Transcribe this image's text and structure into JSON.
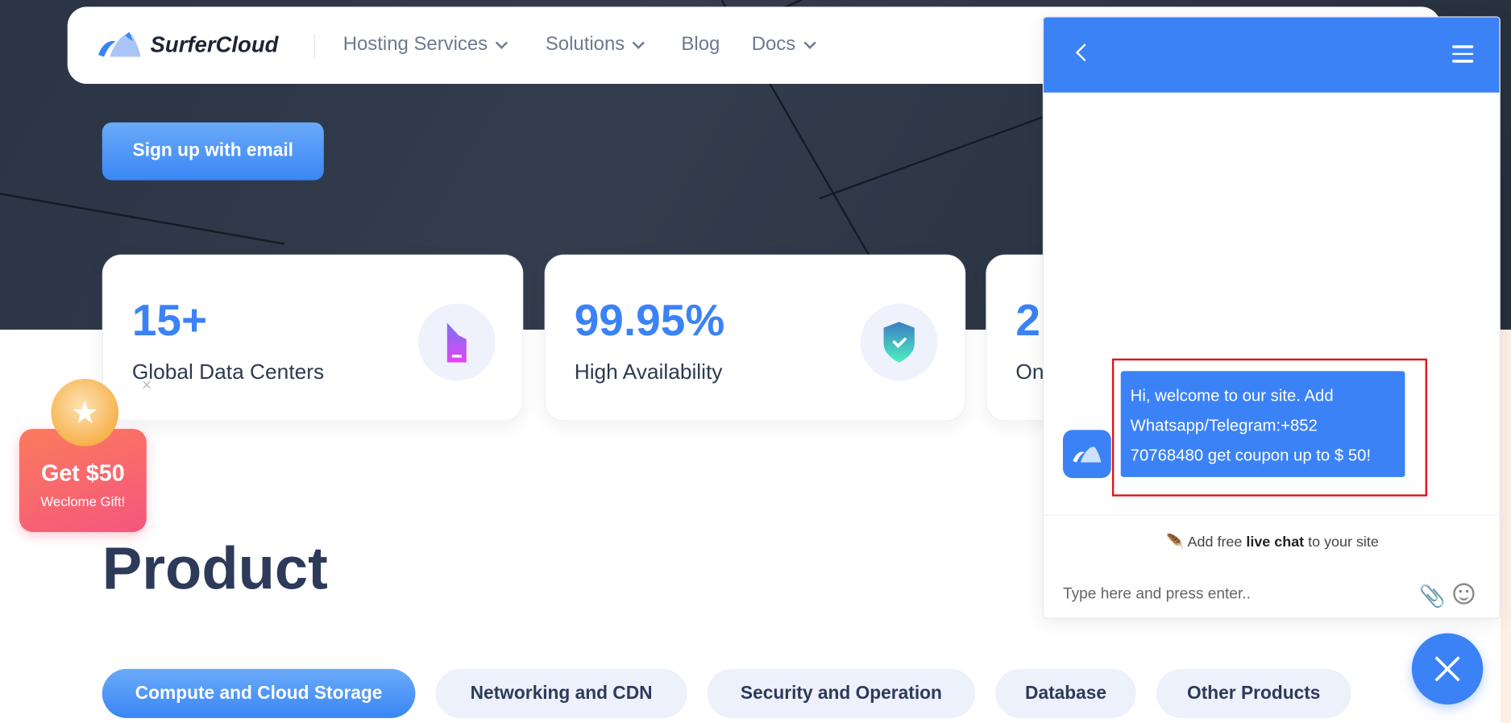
{
  "brand": {
    "name": "SurferCloud",
    "accent": "#3b82f6"
  },
  "nav": {
    "items": [
      {
        "label": "Hosting Services",
        "dropdown": true
      },
      {
        "label": "Solutions",
        "dropdown": true
      },
      {
        "label": "Blog",
        "dropdown": false
      },
      {
        "label": "Docs",
        "dropdown": true
      }
    ]
  },
  "hero": {
    "signup_label": "Sign up with email"
  },
  "stats": [
    {
      "value": "15+",
      "label": "Global Data Centers",
      "icon": "server-icon"
    },
    {
      "value": "99.95%",
      "label": "High Availability",
      "icon": "shield-check-icon"
    },
    {
      "value": "2",
      "label": "On",
      "icon": ""
    }
  ],
  "gift": {
    "title": "Get $50",
    "subtitle": "Weclome Gift!",
    "close": "×"
  },
  "product": {
    "title": "Product",
    "tabs": [
      {
        "label": "Compute and Cloud Storage",
        "active": true
      },
      {
        "label": "Networking and CDN",
        "active": false
      },
      {
        "label": "Security and Operation",
        "active": false
      },
      {
        "label": "Database",
        "active": false
      },
      {
        "label": "Other Products",
        "active": false
      }
    ]
  },
  "chat": {
    "message_lines": [
      "Hi, welcome to our site. Add",
      "Whatsapp/Telegram:+852",
      "70768480 get coupon up to $ 50!"
    ],
    "powered_prefix": "Add free ",
    "powered_bold": "live chat",
    "powered_suffix": " to your site",
    "input_placeholder": "Type here and press enter..",
    "highlight_color": "#e0141e"
  }
}
